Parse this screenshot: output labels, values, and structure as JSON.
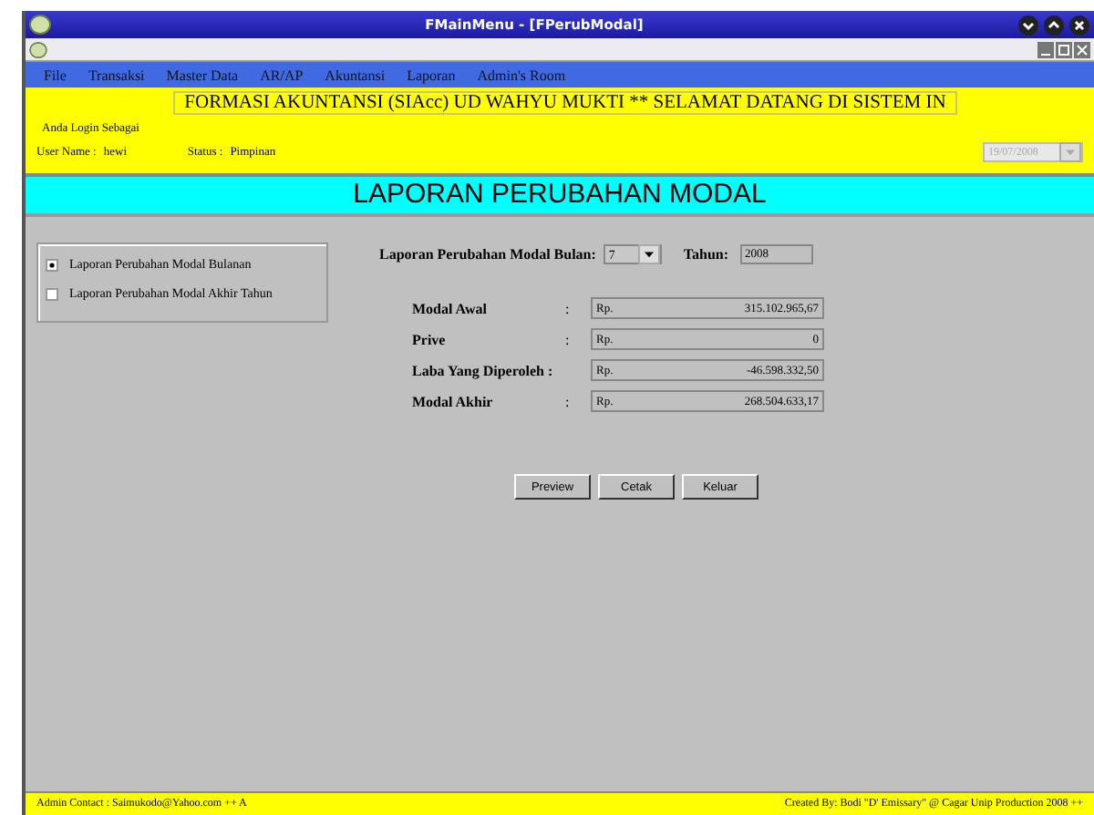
{
  "window": {
    "title": "FMainMenu - [FPerubModal]"
  },
  "menu": [
    "File",
    "Transaksi",
    "Master Data",
    "AR/AP",
    "Akuntansi",
    "Laporan",
    "Admin's Room"
  ],
  "header": {
    "marquee": "FORMASI AKUNTANSI (SIAcc) UD WAHYU MUKTI ** SELAMAT DATANG DI SISTEM IN",
    "login_label": "Anda Login Sebagai",
    "user_label": "User Name :",
    "user": "hewi",
    "status_label": "Status :",
    "status": "Pimpinan",
    "date": "19/07/2008"
  },
  "report_title": "LAPORAN PERUBAHAN MODAL",
  "options": [
    {
      "label": "Laporan Perubahan Modal Bulanan",
      "selected": true
    },
    {
      "label": "Laporan Perubahan Modal Akhir Tahun",
      "selected": false
    }
  ],
  "period": {
    "month_label": "Laporan Perubahan Modal Bulan:",
    "month": "7",
    "year_label": "Tahun:",
    "year": "2008"
  },
  "rows": [
    {
      "label": "Modal Awal",
      "colon": ":",
      "prefix": "Rp.",
      "value": "315.102.965,67"
    },
    {
      "label": "Prive",
      "colon": ":",
      "prefix": "Rp.",
      "value": "0"
    },
    {
      "label": "Laba Yang Diperoleh :",
      "prefix": "Rp.",
      "value": "-46.598.332,50"
    },
    {
      "label": "Modal Akhir",
      "colon": ":",
      "prefix": "Rp.",
      "value": "268.504.633,17"
    }
  ],
  "buttons": [
    "Preview",
    "Cetak",
    "Keluar"
  ],
  "status_bar": {
    "left": "Admin Contact : Saimukodo@Yahoo.com ++ A",
    "right": "Created By: Bodi \"D' Emissary\" @ Cagar Unip Production 2008 ++"
  }
}
